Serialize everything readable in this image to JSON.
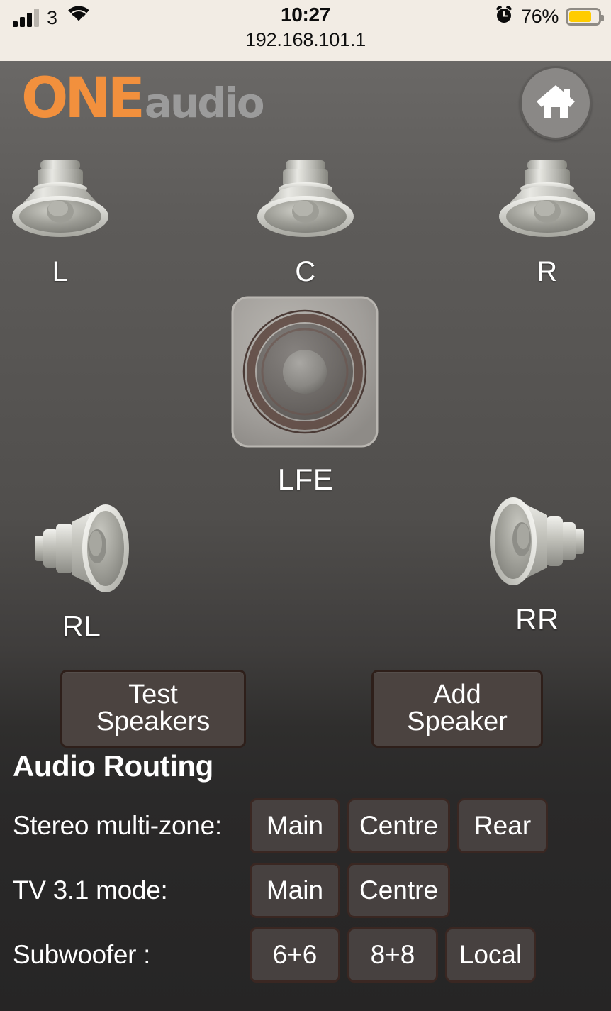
{
  "statusbar": {
    "carrier": "3",
    "time": "10:27",
    "battery_percent": "76%",
    "battery_level": 76,
    "url": "192.168.101.1",
    "signal_icon": "cellular-bars-icon",
    "wifi_icon": "wifi-icon",
    "alarm_icon": "alarm-clock-icon",
    "battery_icon": "battery-icon"
  },
  "header": {
    "logo_primary": "ONE",
    "logo_secondary": "audio",
    "home_icon": "home-icon",
    "logo_primary_color": "#f2903d",
    "logo_secondary_color": "#9b9b9b"
  },
  "speakers": {
    "ceiling": [
      {
        "label": "L",
        "icon": "ceiling-speaker-icon"
      },
      {
        "label": "C",
        "icon": "ceiling-speaker-icon"
      },
      {
        "label": "R",
        "icon": "ceiling-speaker-icon"
      }
    ],
    "sub": {
      "label": "LFE",
      "icon": "subwoofer-icon"
    },
    "rear": [
      {
        "label": "RL",
        "icon": "cone-speaker-right-icon"
      },
      {
        "label": "RR",
        "icon": "cone-speaker-left-icon"
      }
    ]
  },
  "actions": {
    "test_speakers": "Test Speakers",
    "add_speaker": "Add Speaker"
  },
  "routing": {
    "title": "Audio Routing",
    "rows": [
      {
        "label": "Stereo multi-zone:",
        "options": [
          "Main",
          "Centre",
          "Rear"
        ]
      },
      {
        "label": "TV 3.1 mode:",
        "options": [
          "Main",
          "Centre"
        ]
      },
      {
        "label": "Subwoofer :",
        "options": [
          "6+6",
          "8+8",
          "Local"
        ]
      }
    ]
  },
  "colors": {
    "status_bg": "#f2ece4",
    "battery_fill": "#ffcc00",
    "button_bg": "#4b4340",
    "button_border": "#2e1f1a"
  }
}
